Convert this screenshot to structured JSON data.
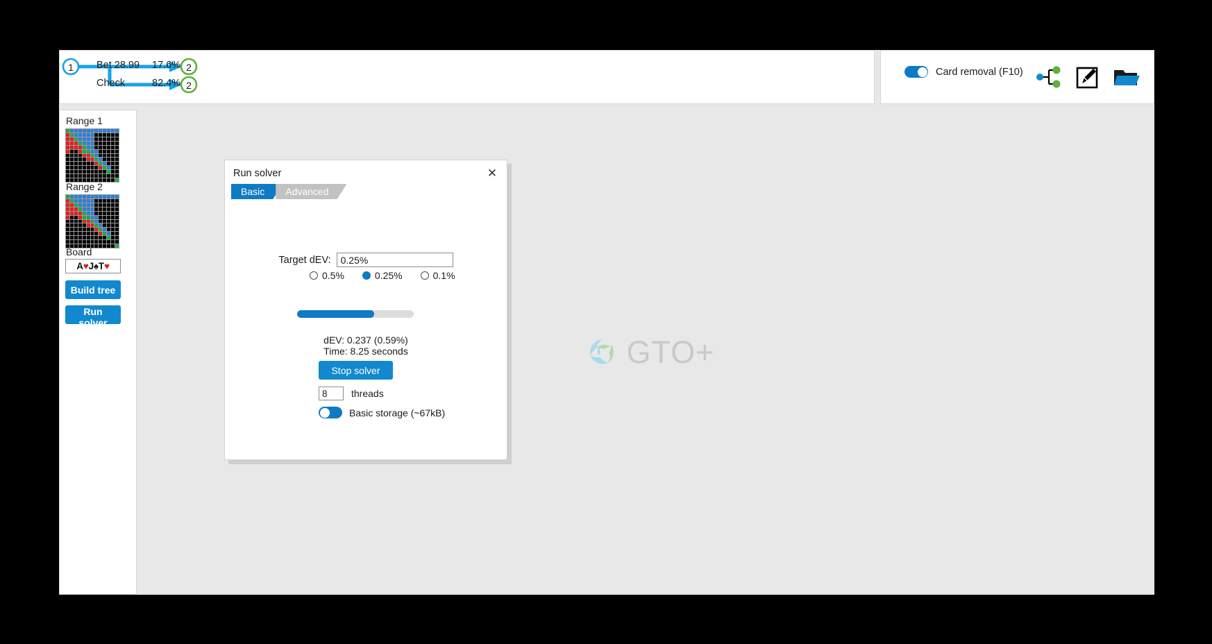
{
  "tree": {
    "root_node": "1",
    "branches": [
      {
        "action": "Bet 28.99",
        "frequency": "17.6%",
        "target_node": "2"
      },
      {
        "action": "Check",
        "frequency": "82.4%",
        "target_node": "2"
      }
    ]
  },
  "toolbar": {
    "card_removal_label": "Card removal (F10)",
    "card_removal_on": true,
    "icons": [
      "tree-graph-icon",
      "edit-pencil-icon",
      "open-folder-icon"
    ]
  },
  "sidebar": {
    "range1_label": "Range 1",
    "range2_label": "Range 2",
    "board_label": "Board",
    "board_cards": [
      {
        "rank": "A",
        "suit": "♥",
        "color": "red"
      },
      {
        "rank": "J",
        "suit": "♠",
        "color": "black"
      },
      {
        "rank": "T",
        "suit": "♥",
        "color": "red"
      }
    ],
    "build_tree_label": "Build tree",
    "run_solver_label": "Run solver"
  },
  "dialog": {
    "title": "Run solver",
    "close_label": "✕",
    "tabs": [
      {
        "label": "Basic",
        "active": true
      },
      {
        "label": "Advanced",
        "active": false
      }
    ],
    "target_dev_label": "Target dEV:",
    "target_dev_value": "0.25%",
    "target_dev_options": [
      {
        "label": "0.5%",
        "selected": false
      },
      {
        "label": "0.25%",
        "selected": true
      },
      {
        "label": "0.1%",
        "selected": false
      }
    ],
    "progress_percent": 66,
    "dev_status": "dEV: 0.237 (0.59%)",
    "time_status": "Time: 8.25 seconds",
    "stop_button_label": "Stop solver",
    "threads_value": "8",
    "threads_label": "threads",
    "storage_label": "Basic storage (~67kB)",
    "storage_on": false
  },
  "canvas": {
    "watermark_text": "GTO+"
  },
  "colors": {
    "accent_blue": "#0f7bc4",
    "button_blue": "#1289cf",
    "node_green": "#5db33c",
    "arrow_blue": "#14a2e8",
    "range_blue": "#2e7fd4",
    "range_red": "#e02020",
    "range_green": "#1faa43",
    "range_black": "#000000"
  }
}
